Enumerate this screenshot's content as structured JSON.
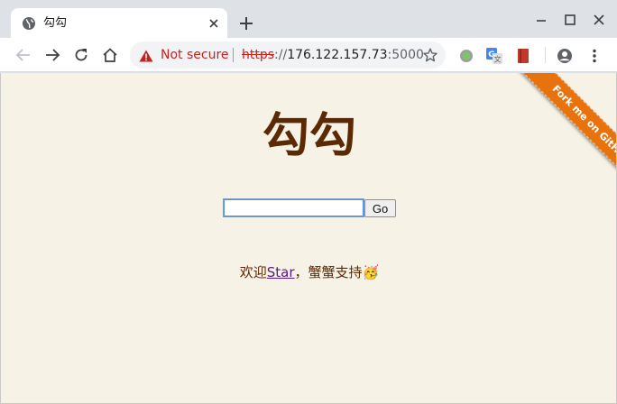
{
  "tab": {
    "title": "勾勾"
  },
  "address_bar": {
    "security_label": "Not secure",
    "url_scheme": "https",
    "url_separator": "://",
    "url_host": "176.122.157.73",
    "url_port": ":5000"
  },
  "page": {
    "title": "勾勾",
    "search": {
      "value": "",
      "placeholder": ""
    },
    "go_label": "Go",
    "welcome_prefix": "欢迎",
    "welcome_link": "Star",
    "welcome_suffix": "，蟹蟹支持🥳"
  },
  "ribbon": {
    "label": "Fork me on GitHub"
  },
  "colors": {
    "page_background": "#f7f2e6",
    "title_color": "#5b2a04",
    "ribbon_color": "#e8730c",
    "not_secure_red": "#c5221f",
    "link_visited": "#551a8b"
  },
  "icons": {
    "tab_favicon": "globe-icon",
    "tab_close": "close-icon",
    "new_tab": "plus-icon",
    "back": "arrow-left-icon",
    "forward": "arrow-right-icon",
    "reload": "reload-icon",
    "home": "home-icon",
    "warning": "warning-icon",
    "bookmark": "star-icon",
    "profile": "account-icon",
    "menu": "kebab-menu-icon"
  }
}
